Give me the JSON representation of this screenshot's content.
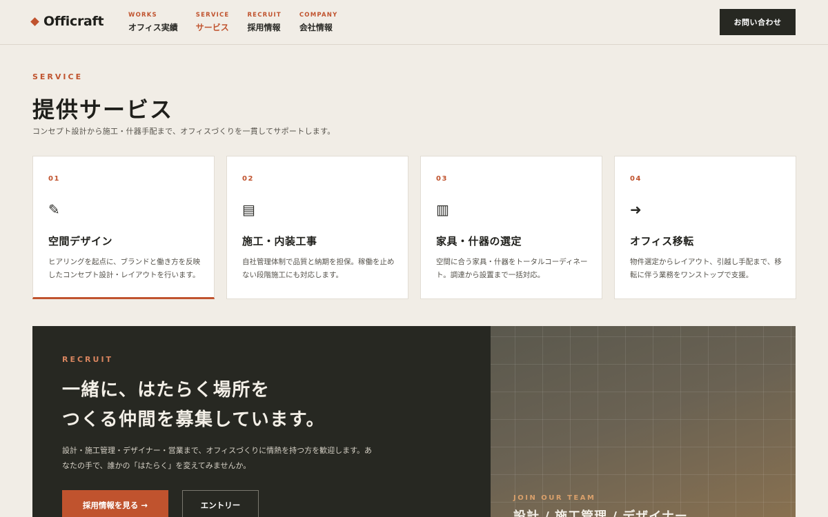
{
  "brand": {
    "name": "Officraft",
    "accent": "#c0532e",
    "dark": "#272822"
  },
  "nav": {
    "items": [
      {
        "en": "WORKS",
        "ja": "オフィス実績"
      },
      {
        "en": "SERVICE",
        "ja": "サービス"
      },
      {
        "en": "RECRUIT",
        "ja": "採用情報"
      },
      {
        "en": "COMPANY",
        "ja": "会社情報"
      }
    ],
    "active": "SERVICE",
    "contact_label": "お問い合わせ"
  },
  "service": {
    "eyebrow": "SERVICE",
    "title": "提供サービス",
    "description": "コンセプト設計から施工・什器手配まで、オフィスづくりを一貫してサポートします。",
    "cards": [
      {
        "num": "01",
        "icon": "pencil-icon",
        "glyph": "✎",
        "title": "空間デザイン",
        "desc": "ヒアリングを起点に、ブランドと働き方を反映したコンセプト設計・レイアウトを行います。"
      },
      {
        "num": "02",
        "icon": "construction-icon",
        "glyph": "▤",
        "title": "施工・内装工事",
        "desc": "自社管理体制で品質と納期を担保。稼働を止めない段階施工にも対応します。"
      },
      {
        "num": "03",
        "icon": "furniture-icon",
        "glyph": "▥",
        "title": "家具・什器の選定",
        "desc": "空間に合う家具・什器をトータルコーディネート。調達から設置まで一括対応。"
      },
      {
        "num": "04",
        "icon": "arrow-right-icon",
        "glyph": "➜",
        "title": "オフィス移転",
        "desc": "物件選定からレイアウト、引越し手配まで、移転に伴う業務をワンストップで支援。"
      }
    ]
  },
  "recruit": {
    "eyebrow": "RECRUIT",
    "title_line1": "一緒に、はたらく場所を",
    "title_line2": "つくる仲間を募集しています。",
    "description": "設計・施工管理・デザイナー・営業まで、オフィスづくりに情熱を持つ方を歓迎します。あなたの手で、誰かの「はたらく」を変えてみませんか。",
    "primary_button": "採用情報を見る →",
    "secondary_button": "エントリー",
    "team_eyebrow": "JOIN OUR TEAM",
    "team_title": "設計 / 施工管理 / デザイナー"
  }
}
